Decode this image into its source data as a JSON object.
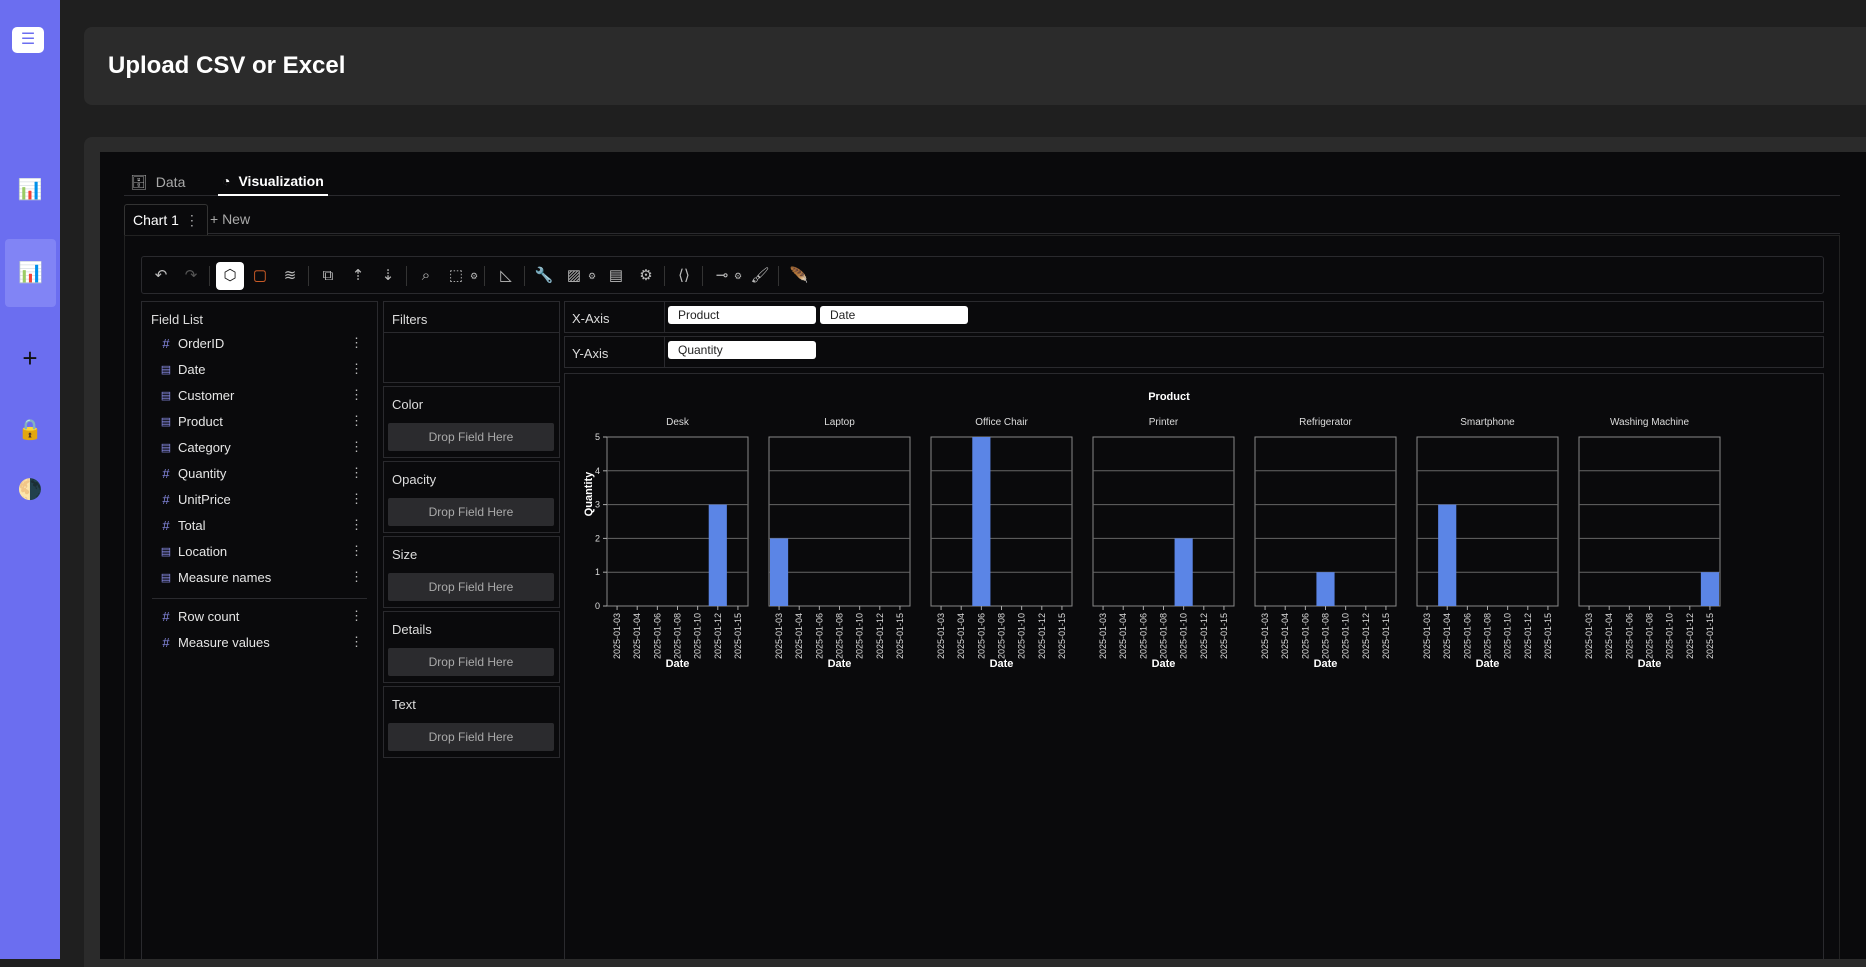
{
  "page": {
    "title": "Upload CSV or Excel"
  },
  "sidebar": {
    "icons": [
      "menu-icon",
      "bar-chart-icon",
      "bar-chart-icon",
      "plus-icon",
      "lock-icon",
      "theme-icon"
    ]
  },
  "tabs": [
    {
      "label": "Data",
      "icon": "database-icon"
    },
    {
      "label": "Visualization",
      "icon": "chart-icon"
    }
  ],
  "chart_tabs": {
    "current": "Chart 1",
    "new_label": "+ New"
  },
  "field_list": {
    "title": "Field List",
    "dimensions": [
      {
        "name": "OrderID",
        "kind": "measure"
      },
      {
        "name": "Date",
        "kind": "dimension"
      },
      {
        "name": "Customer",
        "kind": "dimension"
      },
      {
        "name": "Product",
        "kind": "dimension"
      },
      {
        "name": "Category",
        "kind": "dimension"
      },
      {
        "name": "Quantity",
        "kind": "measure"
      },
      {
        "name": "UnitPrice",
        "kind": "measure"
      },
      {
        "name": "Total",
        "kind": "measure"
      },
      {
        "name": "Location",
        "kind": "dimension"
      },
      {
        "name": "Measure names",
        "kind": "dimension"
      }
    ],
    "measures": [
      {
        "name": "Row count",
        "kind": "measure"
      },
      {
        "name": "Measure values",
        "kind": "measure"
      }
    ]
  },
  "encodings": {
    "filters": "Filters",
    "color": "Color",
    "opacity": "Opacity",
    "size": "Size",
    "details": "Details",
    "text": "Text",
    "drop_placeholder": "Drop Field Here"
  },
  "axes": {
    "x_label": "X-Axis",
    "x_fields": [
      "Product",
      "Date"
    ],
    "y_label": "Y-Axis",
    "y_fields": [
      "Quantity"
    ]
  },
  "chart_data": {
    "type": "bar",
    "title": "Product",
    "xlabel": "Date",
    "ylabel": "Quantity",
    "ylim": [
      0,
      5
    ],
    "y_ticks": [
      "0",
      "1",
      "2",
      "3",
      "4",
      "5"
    ],
    "x_ticks": [
      "2025-01-03",
      "2025-01-04",
      "2025-01-06",
      "2025-01-08",
      "2025-01-10",
      "2025-01-12",
      "2025-01-15"
    ],
    "bar_color": "#5b85e6",
    "facets": [
      {
        "name": "Desk",
        "bars": [
          {
            "x": "2025-01-12",
            "y": 3
          }
        ]
      },
      {
        "name": "Laptop",
        "bars": [
          {
            "x": "2025-01-03",
            "y": 2
          }
        ]
      },
      {
        "name": "Office Chair",
        "bars": [
          {
            "x": "2025-01-06",
            "y": 5
          }
        ]
      },
      {
        "name": "Printer",
        "bars": [
          {
            "x": "2025-01-10",
            "y": 2
          }
        ]
      },
      {
        "name": "Refrigerator",
        "bars": [
          {
            "x": "2025-01-08",
            "y": 1
          }
        ]
      },
      {
        "name": "Smartphone",
        "bars": [
          {
            "x": "2025-01-04",
            "y": 3
          }
        ]
      },
      {
        "name": "Washing Machine",
        "bars": [
          {
            "x": "2025-01-15",
            "y": 1
          }
        ]
      }
    ]
  }
}
